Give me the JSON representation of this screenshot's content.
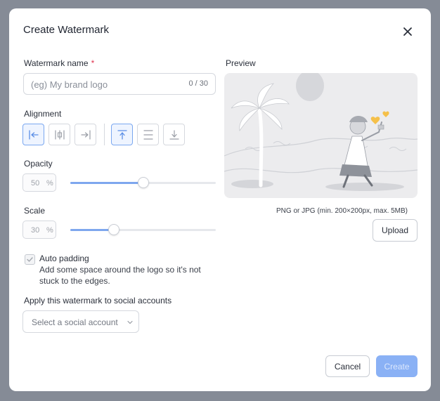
{
  "dialog": {
    "title": "Create Watermark"
  },
  "form": {
    "name_label": "Watermark name",
    "required_mark": "*",
    "name_placeholder": "(eg) My brand logo",
    "name_counter": "0 / 30",
    "alignment_label": "Alignment",
    "alignment_options": [
      "align-left",
      "align-center",
      "align-right",
      "align-top",
      "align-middle",
      "align-bottom"
    ],
    "opacity_label": "Opacity",
    "opacity_value": "50",
    "opacity_unit": "%",
    "opacity_level": 50,
    "scale_label": "Scale",
    "scale_value": "30",
    "scale_unit": "%",
    "scale_level": 30,
    "auto_padding_label": "Auto padding",
    "auto_padding_checked": true,
    "auto_padding_desc": "Add some space around the logo so it's not stuck to the edges.",
    "social_label": "Apply this watermark to social accounts",
    "social_placeholder": "Select a social account"
  },
  "preview": {
    "label": "Preview",
    "hint": "PNG or JPG (min. 200×200px, max. 5MB)",
    "upload_label": "Upload"
  },
  "footer": {
    "cancel_label": "Cancel",
    "create_label": "Create"
  },
  "colors": {
    "accent": "#7ea7ee",
    "primary_button": "#8ab1f5",
    "required": "#e0344f",
    "backdrop": "#858b96"
  }
}
